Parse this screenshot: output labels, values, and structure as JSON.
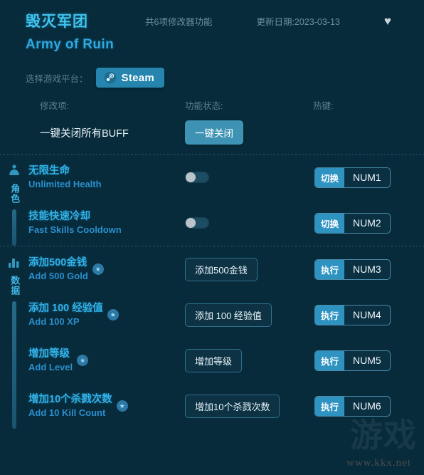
{
  "header": {
    "title_cn": "毁灭军团",
    "title_en": "Army of Ruin",
    "feature_count": "共6项修改器功能",
    "update_date": "更新日期:2023-03-13",
    "favorite_icon": "♥"
  },
  "platform": {
    "label": "选择游戏平台：",
    "selected": "Steam",
    "icon": "steam-icon"
  },
  "columns": {
    "modifier": "修改项:",
    "status": "功能状态:",
    "hotkey": "热键:"
  },
  "master": {
    "name": "一键关闭所有BUFF",
    "button": "一键关闭"
  },
  "sections": [
    {
      "rail_label": "角色",
      "rail_icon": "character-icon",
      "rows": [
        {
          "name_cn": "无限生命",
          "name_en": "Unlimited Health",
          "control": "toggle",
          "toggle_on": false,
          "hotkey_action": "切换",
          "hotkey_key": "NUM1",
          "starred": false
        },
        {
          "name_cn": "技能快速冷却",
          "name_en": "Fast Skills Cooldown",
          "control": "toggle",
          "toggle_on": false,
          "hotkey_action": "切换",
          "hotkey_key": "NUM2",
          "starred": false
        }
      ]
    },
    {
      "rail_label": "数据",
      "rail_icon": "data-bars-icon",
      "rows": [
        {
          "name_cn": "添加500金钱",
          "name_en": "Add 500 Gold",
          "control": "button",
          "button_label": "添加500金钱",
          "hotkey_action": "执行",
          "hotkey_key": "NUM3",
          "starred": true
        },
        {
          "name_cn": "添加 100 经验值",
          "name_en": "Add 100 XP",
          "control": "button",
          "button_label": "添加 100 经验值",
          "hotkey_action": "执行",
          "hotkey_key": "NUM4",
          "starred": true
        },
        {
          "name_cn": "增加等级",
          "name_en": "Add Level",
          "control": "button",
          "button_label": "增加等级",
          "hotkey_action": "执行",
          "hotkey_key": "NUM5",
          "starred": true
        },
        {
          "name_cn": "增加10个杀戮次数",
          "name_en": "Add 10 Kill Count",
          "control": "button",
          "button_label": "增加10个杀戮次数",
          "hotkey_action": "执行",
          "hotkey_key": "NUM6",
          "starred": true
        }
      ]
    }
  ],
  "watermark": {
    "glyph": "游戏",
    "url": "www.kkx.net"
  },
  "colors": {
    "background": "#072b3a",
    "accent": "#31b2e8",
    "steam_blue": "#2585ae",
    "button_blue": "#3e93b5"
  }
}
